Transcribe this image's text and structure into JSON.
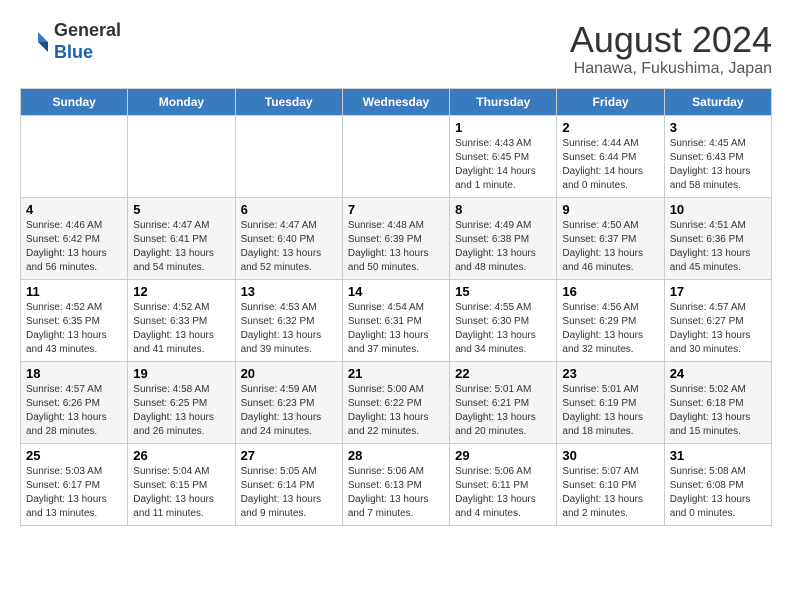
{
  "header": {
    "logo_line1": "General",
    "logo_line2": "Blue",
    "title": "August 2024",
    "subtitle": "Hanawa, Fukushima, Japan"
  },
  "calendar": {
    "days_of_week": [
      "Sunday",
      "Monday",
      "Tuesday",
      "Wednesday",
      "Thursday",
      "Friday",
      "Saturday"
    ],
    "weeks": [
      [
        {
          "day": "",
          "info": ""
        },
        {
          "day": "",
          "info": ""
        },
        {
          "day": "",
          "info": ""
        },
        {
          "day": "",
          "info": ""
        },
        {
          "day": "1",
          "info": "Sunrise: 4:43 AM\nSunset: 6:45 PM\nDaylight: 14 hours\nand 1 minute."
        },
        {
          "day": "2",
          "info": "Sunrise: 4:44 AM\nSunset: 6:44 PM\nDaylight: 14 hours\nand 0 minutes."
        },
        {
          "day": "3",
          "info": "Sunrise: 4:45 AM\nSunset: 6:43 PM\nDaylight: 13 hours\nand 58 minutes."
        }
      ],
      [
        {
          "day": "4",
          "info": "Sunrise: 4:46 AM\nSunset: 6:42 PM\nDaylight: 13 hours\nand 56 minutes."
        },
        {
          "day": "5",
          "info": "Sunrise: 4:47 AM\nSunset: 6:41 PM\nDaylight: 13 hours\nand 54 minutes."
        },
        {
          "day": "6",
          "info": "Sunrise: 4:47 AM\nSunset: 6:40 PM\nDaylight: 13 hours\nand 52 minutes."
        },
        {
          "day": "7",
          "info": "Sunrise: 4:48 AM\nSunset: 6:39 PM\nDaylight: 13 hours\nand 50 minutes."
        },
        {
          "day": "8",
          "info": "Sunrise: 4:49 AM\nSunset: 6:38 PM\nDaylight: 13 hours\nand 48 minutes."
        },
        {
          "day": "9",
          "info": "Sunrise: 4:50 AM\nSunset: 6:37 PM\nDaylight: 13 hours\nand 46 minutes."
        },
        {
          "day": "10",
          "info": "Sunrise: 4:51 AM\nSunset: 6:36 PM\nDaylight: 13 hours\nand 45 minutes."
        }
      ],
      [
        {
          "day": "11",
          "info": "Sunrise: 4:52 AM\nSunset: 6:35 PM\nDaylight: 13 hours\nand 43 minutes."
        },
        {
          "day": "12",
          "info": "Sunrise: 4:52 AM\nSunset: 6:33 PM\nDaylight: 13 hours\nand 41 minutes."
        },
        {
          "day": "13",
          "info": "Sunrise: 4:53 AM\nSunset: 6:32 PM\nDaylight: 13 hours\nand 39 minutes."
        },
        {
          "day": "14",
          "info": "Sunrise: 4:54 AM\nSunset: 6:31 PM\nDaylight: 13 hours\nand 37 minutes."
        },
        {
          "day": "15",
          "info": "Sunrise: 4:55 AM\nSunset: 6:30 PM\nDaylight: 13 hours\nand 34 minutes."
        },
        {
          "day": "16",
          "info": "Sunrise: 4:56 AM\nSunset: 6:29 PM\nDaylight: 13 hours\nand 32 minutes."
        },
        {
          "day": "17",
          "info": "Sunrise: 4:57 AM\nSunset: 6:27 PM\nDaylight: 13 hours\nand 30 minutes."
        }
      ],
      [
        {
          "day": "18",
          "info": "Sunrise: 4:57 AM\nSunset: 6:26 PM\nDaylight: 13 hours\nand 28 minutes."
        },
        {
          "day": "19",
          "info": "Sunrise: 4:58 AM\nSunset: 6:25 PM\nDaylight: 13 hours\nand 26 minutes."
        },
        {
          "day": "20",
          "info": "Sunrise: 4:59 AM\nSunset: 6:23 PM\nDaylight: 13 hours\nand 24 minutes."
        },
        {
          "day": "21",
          "info": "Sunrise: 5:00 AM\nSunset: 6:22 PM\nDaylight: 13 hours\nand 22 minutes."
        },
        {
          "day": "22",
          "info": "Sunrise: 5:01 AM\nSunset: 6:21 PM\nDaylight: 13 hours\nand 20 minutes."
        },
        {
          "day": "23",
          "info": "Sunrise: 5:01 AM\nSunset: 6:19 PM\nDaylight: 13 hours\nand 18 minutes."
        },
        {
          "day": "24",
          "info": "Sunrise: 5:02 AM\nSunset: 6:18 PM\nDaylight: 13 hours\nand 15 minutes."
        }
      ],
      [
        {
          "day": "25",
          "info": "Sunrise: 5:03 AM\nSunset: 6:17 PM\nDaylight: 13 hours\nand 13 minutes."
        },
        {
          "day": "26",
          "info": "Sunrise: 5:04 AM\nSunset: 6:15 PM\nDaylight: 13 hours\nand 11 minutes."
        },
        {
          "day": "27",
          "info": "Sunrise: 5:05 AM\nSunset: 6:14 PM\nDaylight: 13 hours\nand 9 minutes."
        },
        {
          "day": "28",
          "info": "Sunrise: 5:06 AM\nSunset: 6:13 PM\nDaylight: 13 hours\nand 7 minutes."
        },
        {
          "day": "29",
          "info": "Sunrise: 5:06 AM\nSunset: 6:11 PM\nDaylight: 13 hours\nand 4 minutes."
        },
        {
          "day": "30",
          "info": "Sunrise: 5:07 AM\nSunset: 6:10 PM\nDaylight: 13 hours\nand 2 minutes."
        },
        {
          "day": "31",
          "info": "Sunrise: 5:08 AM\nSunset: 6:08 PM\nDaylight: 13 hours\nand 0 minutes."
        }
      ]
    ]
  }
}
